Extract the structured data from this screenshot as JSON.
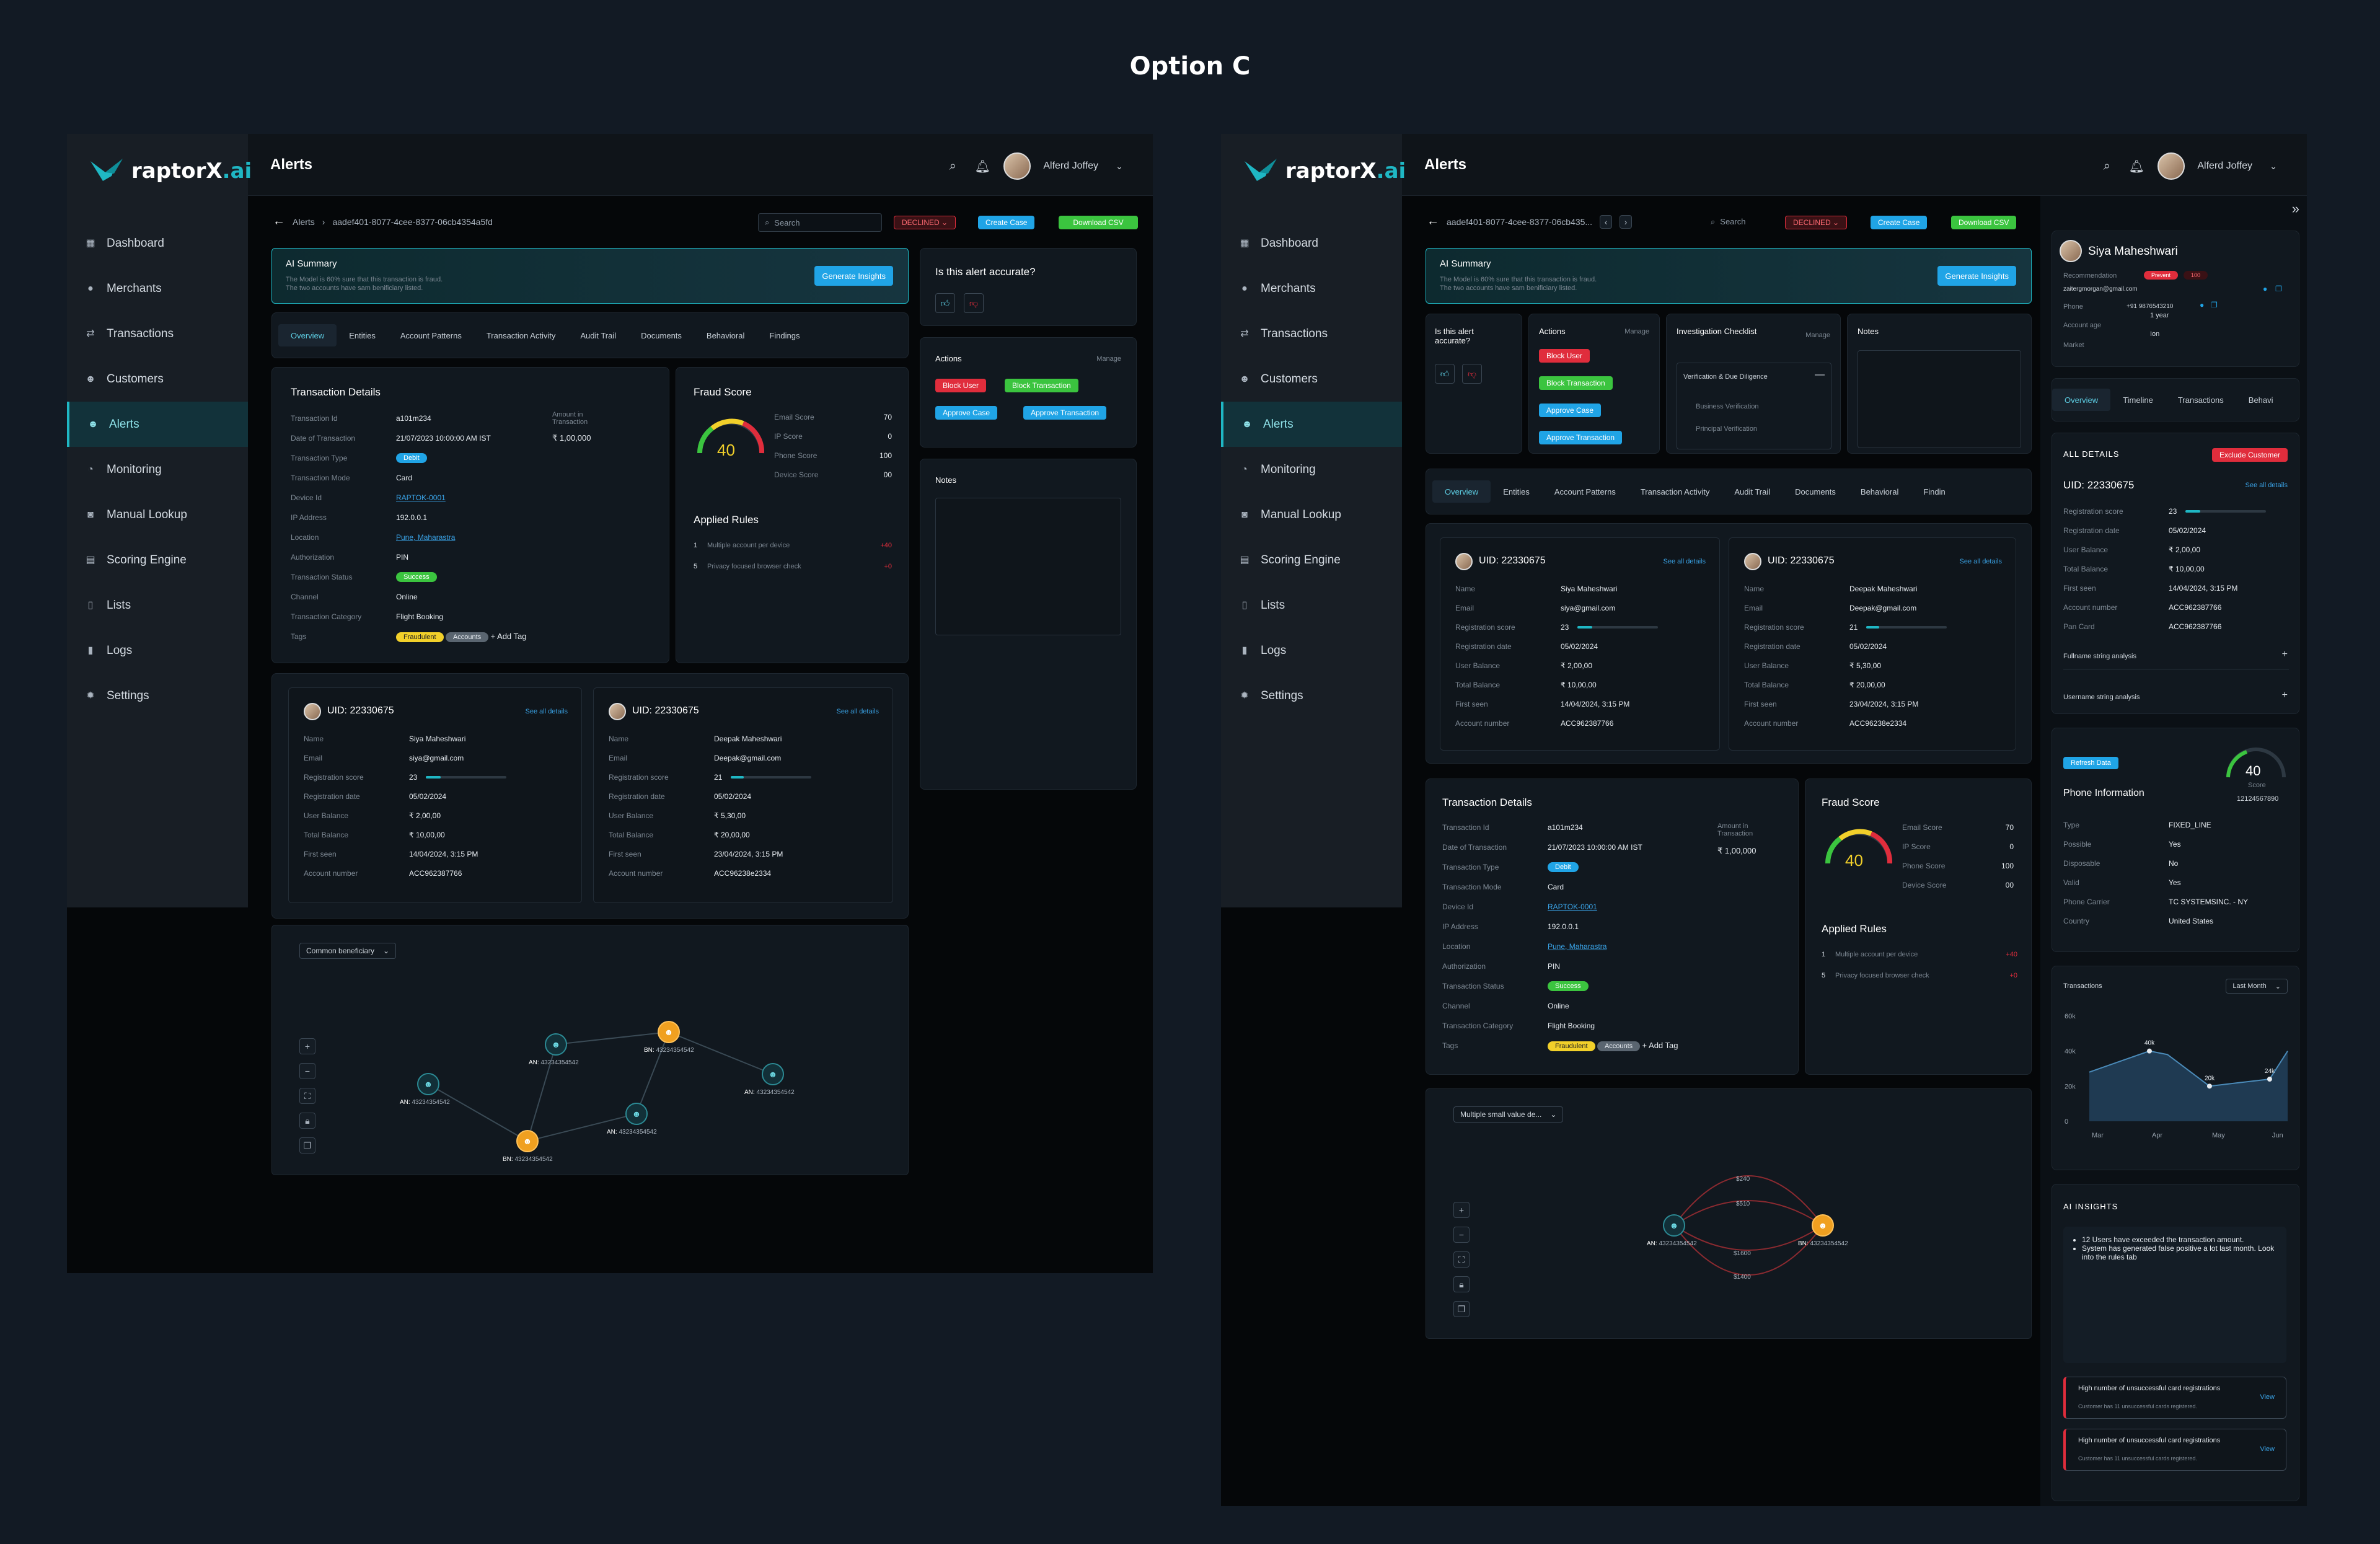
{
  "page_title": "Option C",
  "brand": {
    "name_a": "raptorX",
    "name_b": ".ai"
  },
  "nav": [
    "Dashboard",
    "Merchants",
    "Transactions",
    "Customers",
    "Alerts",
    "Monitoring",
    "Manual Lookup",
    "Scoring Engine",
    "Lists",
    "Logs",
    "Settings"
  ],
  "header": {
    "title": "Alerts",
    "user": "Alferd Joffey"
  },
  "f1": {
    "breadcrumb_root": "Alerts",
    "alert_id": "aadef401-8077-4cee-8377-06cb4354a5fd",
    "search_placeholder": "Search",
    "status": "DECLINED",
    "create_case": "Create Case",
    "download_csv": "Download CSV",
    "ai_summary_title": "AI Summary",
    "ai_summary_l1": "The Model is 60% sure that this transaction is fraud.",
    "ai_summary_l2": "The two accounts have sam benificiary listed.",
    "generate": "Generate Insights",
    "tabs": [
      "Overview",
      "Entities",
      "Account Patterns",
      "Transaction Activity",
      "Audit Trail",
      "Documents",
      "Behavioral",
      "Findings"
    ],
    "accurate_q": "Is this alert accurate?",
    "actions_title": "Actions",
    "manage": "Manage",
    "block_user": "Block User",
    "block_txn": "Block Transaction",
    "approve_case": "Approve Case",
    "approve_txn": "Approve Transaction",
    "notes": "Notes"
  },
  "txn": {
    "title": "Transaction Details",
    "rows": [
      {
        "k": "Transaction Id",
        "v": "a101m234"
      },
      {
        "k": "Date of Transaction",
        "v": "21/07/2023 10:00:00 AM IST"
      },
      {
        "k": "Transaction Type",
        "v": "Debit"
      },
      {
        "k": "Transaction Mode",
        "v": "Card"
      },
      {
        "k": "Device Id",
        "v": "RAPTOK-0001"
      },
      {
        "k": "IP Address",
        "v": "192.0.0.1"
      },
      {
        "k": "Location",
        "v": "Pune, Maharastra"
      },
      {
        "k": "Authorization",
        "v": "PIN"
      },
      {
        "k": "Transaction Status",
        "v": "Success"
      },
      {
        "k": "Channel",
        "v": "Online"
      },
      {
        "k": "Transaction Category",
        "v": "Flight Booking"
      },
      {
        "k": "Tags",
        "v": ""
      }
    ],
    "amount_label": "Amount in Transaction",
    "amount": "₹ 1,00,000",
    "tag1": "Fraudulent",
    "tag2": "Accounts",
    "add_tag": "+ Add Tag"
  },
  "fraud": {
    "title": "Fraud Score",
    "score": "40",
    "items": [
      {
        "k": "Email Score",
        "v": "70"
      },
      {
        "k": "IP Score",
        "v": "0"
      },
      {
        "k": "Phone Score",
        "v": "100"
      },
      {
        "k": "Device Score",
        "v": "00"
      }
    ],
    "rules_title": "Applied Rules",
    "rules": [
      {
        "n": "1",
        "d": "Multiple account per device",
        "s": "+40"
      },
      {
        "n": "5",
        "d": "Privacy focused browser check",
        "s": "+0"
      }
    ]
  },
  "uid": {
    "see_all": "See all details",
    "a": {
      "uid": "UID: 22330675",
      "name": "Siya Maheshwari",
      "email": "siya@gmail.com",
      "reg_score": "23",
      "reg_score_frac": 0.18,
      "reg_date": "05/02/2024",
      "user_bal": "₹ 2,00,00",
      "total_bal": "₹ 10,00,00",
      "first_seen": "14/04/2024, 3:15 PM",
      "acct": "ACC962387766"
    },
    "b": {
      "uid": "UID: 22330675",
      "name": "Deepak Maheshwari",
      "email": "Deepak@gmail.com",
      "reg_score": "21",
      "reg_score_frac": 0.16,
      "reg_date": "05/02/2024",
      "user_bal": "₹ 5,30,00",
      "total_bal": "₹ 20,00,00",
      "first_seen": "23/04/2024, 3:15 PM",
      "acct": "ACC96238e2334"
    },
    "labels": [
      "Name",
      "Email",
      "Registration score",
      "Registration date",
      "User Balance",
      "Total Balance",
      "First seen",
      "Account number"
    ]
  },
  "graph1": {
    "dropdown": "Common beneficiary",
    "nodes": [
      {
        "pre": "AN:",
        "id": "43234354542"
      },
      {
        "pre": "AN:",
        "id": "43234354542"
      },
      {
        "pre": "BN:",
        "id": "43234354542"
      },
      {
        "pre": "AN:",
        "id": "43234354542"
      },
      {
        "pre": "BN:",
        "id": "43234354542"
      },
      {
        "pre": "AN:",
        "id": "43234354542"
      }
    ]
  },
  "f2": {
    "alert_id": "aadef401-8077-4cee-8377-06cb435...",
    "search": "Search",
    "is_accurate": "Is this alert accurate?",
    "checklist_title": "Investigation Checklist",
    "checklist_head": "Verification & Due Diligence",
    "checklist_items": [
      "Business Verification",
      "Principal Verification"
    ],
    "tabs": [
      "Overview",
      "Entities",
      "Account Patterns",
      "Transaction Activity",
      "Audit Trail",
      "Documents",
      "Behavioral",
      "Findin"
    ],
    "graph_dropdown": "Multiple small value de...",
    "edge_labels": [
      "$240",
      "$510",
      "$1600",
      "$1400"
    ]
  },
  "profile": {
    "name": "Siya Maheshwari",
    "rec_label": "Recommendation",
    "rec_value": "Prevent",
    "rec_score": "100",
    "email": "zaitergmorgan@gmail.com",
    "phone_label": "Phone",
    "phone": "+91 9876543210",
    "age_label": "Account age",
    "age": "1 year",
    "market_label": "Market",
    "market": "Ion",
    "tabs": [
      "Overview",
      "Timeline",
      "Transactions",
      "Behavi"
    ],
    "all_details": "ALL DETAILS",
    "exclude": "Exclude Customer",
    "uid": "UID: 22330675",
    "see_all": "See all details",
    "rows": [
      {
        "k": "Registration score",
        "v": "23"
      },
      {
        "k": "Registration date",
        "v": "05/02/2024"
      },
      {
        "k": "User Balance",
        "v": "₹ 2,00,00"
      },
      {
        "k": "Total Balance",
        "v": "₹ 10,00,00"
      },
      {
        "k": "First seen",
        "v": "14/04/2024, 3:15 PM"
      },
      {
        "k": "Account number",
        "v": "ACC962387766"
      },
      {
        "k": "Pan Card",
        "v": "ACC962387766"
      }
    ],
    "fullname": "Fullname string analysis",
    "username": "Username string analysis"
  },
  "phone_info": {
    "refresh": "Refresh Data",
    "title": "Phone Information",
    "score": "40",
    "score_label": "Score",
    "number": "12124567890",
    "rows": [
      {
        "k": "Type",
        "v": "FIXED_LINE"
      },
      {
        "k": "Possible",
        "v": "Yes"
      },
      {
        "k": "Disposable",
        "v": "No"
      },
      {
        "k": "Valid",
        "v": "Yes"
      },
      {
        "k": "Phone Carrier",
        "v": "TC SYSTEMSINC. - NY"
      },
      {
        "k": "Country",
        "v": "United States"
      }
    ]
  },
  "chart_data": {
    "type": "area",
    "title": "Transactions",
    "range_select": "Last Month",
    "categories": [
      "Mar",
      "Apr",
      "May",
      "Jun"
    ],
    "x": [
      0,
      1,
      1.3,
      2,
      2.5,
      3,
      3.3
    ],
    "values": [
      28,
      40,
      38,
      20,
      22,
      24,
      40
    ],
    "point_labels": [
      {
        "i": 1,
        "t": "40k"
      },
      {
        "i": 3,
        "t": "20k"
      },
      {
        "i": 5,
        "t": "24k"
      }
    ],
    "yticks": [
      "60k",
      "40k",
      "20k",
      "0"
    ],
    "ylim": [
      0,
      60
    ]
  },
  "insights": {
    "title": "AI INSIGHTS",
    "bullets": [
      "12 Users have exceeded the transaction amount.",
      "System has generated false positive a lot last month. Look into the rules tab"
    ],
    "cards": [
      {
        "title": "High number of unsuccessful card registrations",
        "sub": "Customer has 11 unsuccessful cards registered.",
        "link": "View"
      },
      {
        "title": "High number of unsuccessful card registrations",
        "sub": "Customer has 11 unsuccessful cards registered.",
        "link": "View"
      }
    ]
  },
  "colors": {
    "accent": "#1fb7c4",
    "danger": "#e02d3c",
    "success": "#3bc43f",
    "info": "#20a4e6",
    "warning": "#f0a020"
  }
}
